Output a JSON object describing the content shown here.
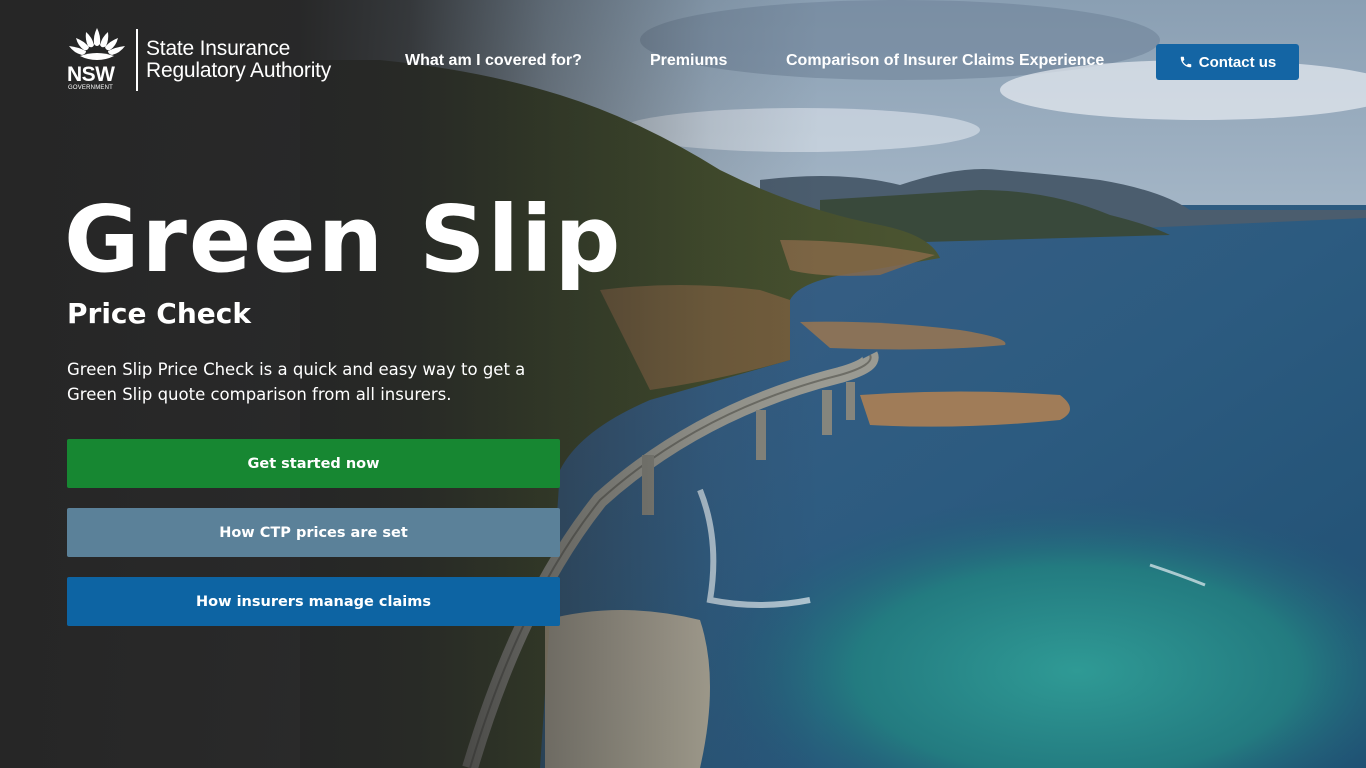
{
  "header": {
    "logo": {
      "brand": "NSW",
      "brand_sub": "GOVERNMENT",
      "org_line1": "State Insurance",
      "org_line2": "Regulatory Authority"
    },
    "nav": [
      {
        "label": "What am I covered for?"
      },
      {
        "label": "Premiums"
      },
      {
        "label": "Comparison of Insurer Claims Experience"
      }
    ],
    "contact_label": "Contact us"
  },
  "hero": {
    "title": "Green Slip",
    "subtitle": "Price Check",
    "description": "Green Slip Price Check is a quick and easy way to get a Green Slip quote comparison from all insurers.",
    "buttons": [
      {
        "label": "Get started now",
        "color": "#178732"
      },
      {
        "label": "How CTP prices are set",
        "color": "#5b8199"
      },
      {
        "label": "How insurers manage claims",
        "color": "#0d64a3"
      }
    ]
  },
  "colors": {
    "page_bg": "#2a2a2a",
    "contact_bg": "#1465a4",
    "text": "#ffffff"
  },
  "icons": [
    "waratah-icon",
    "phone-icon"
  ]
}
